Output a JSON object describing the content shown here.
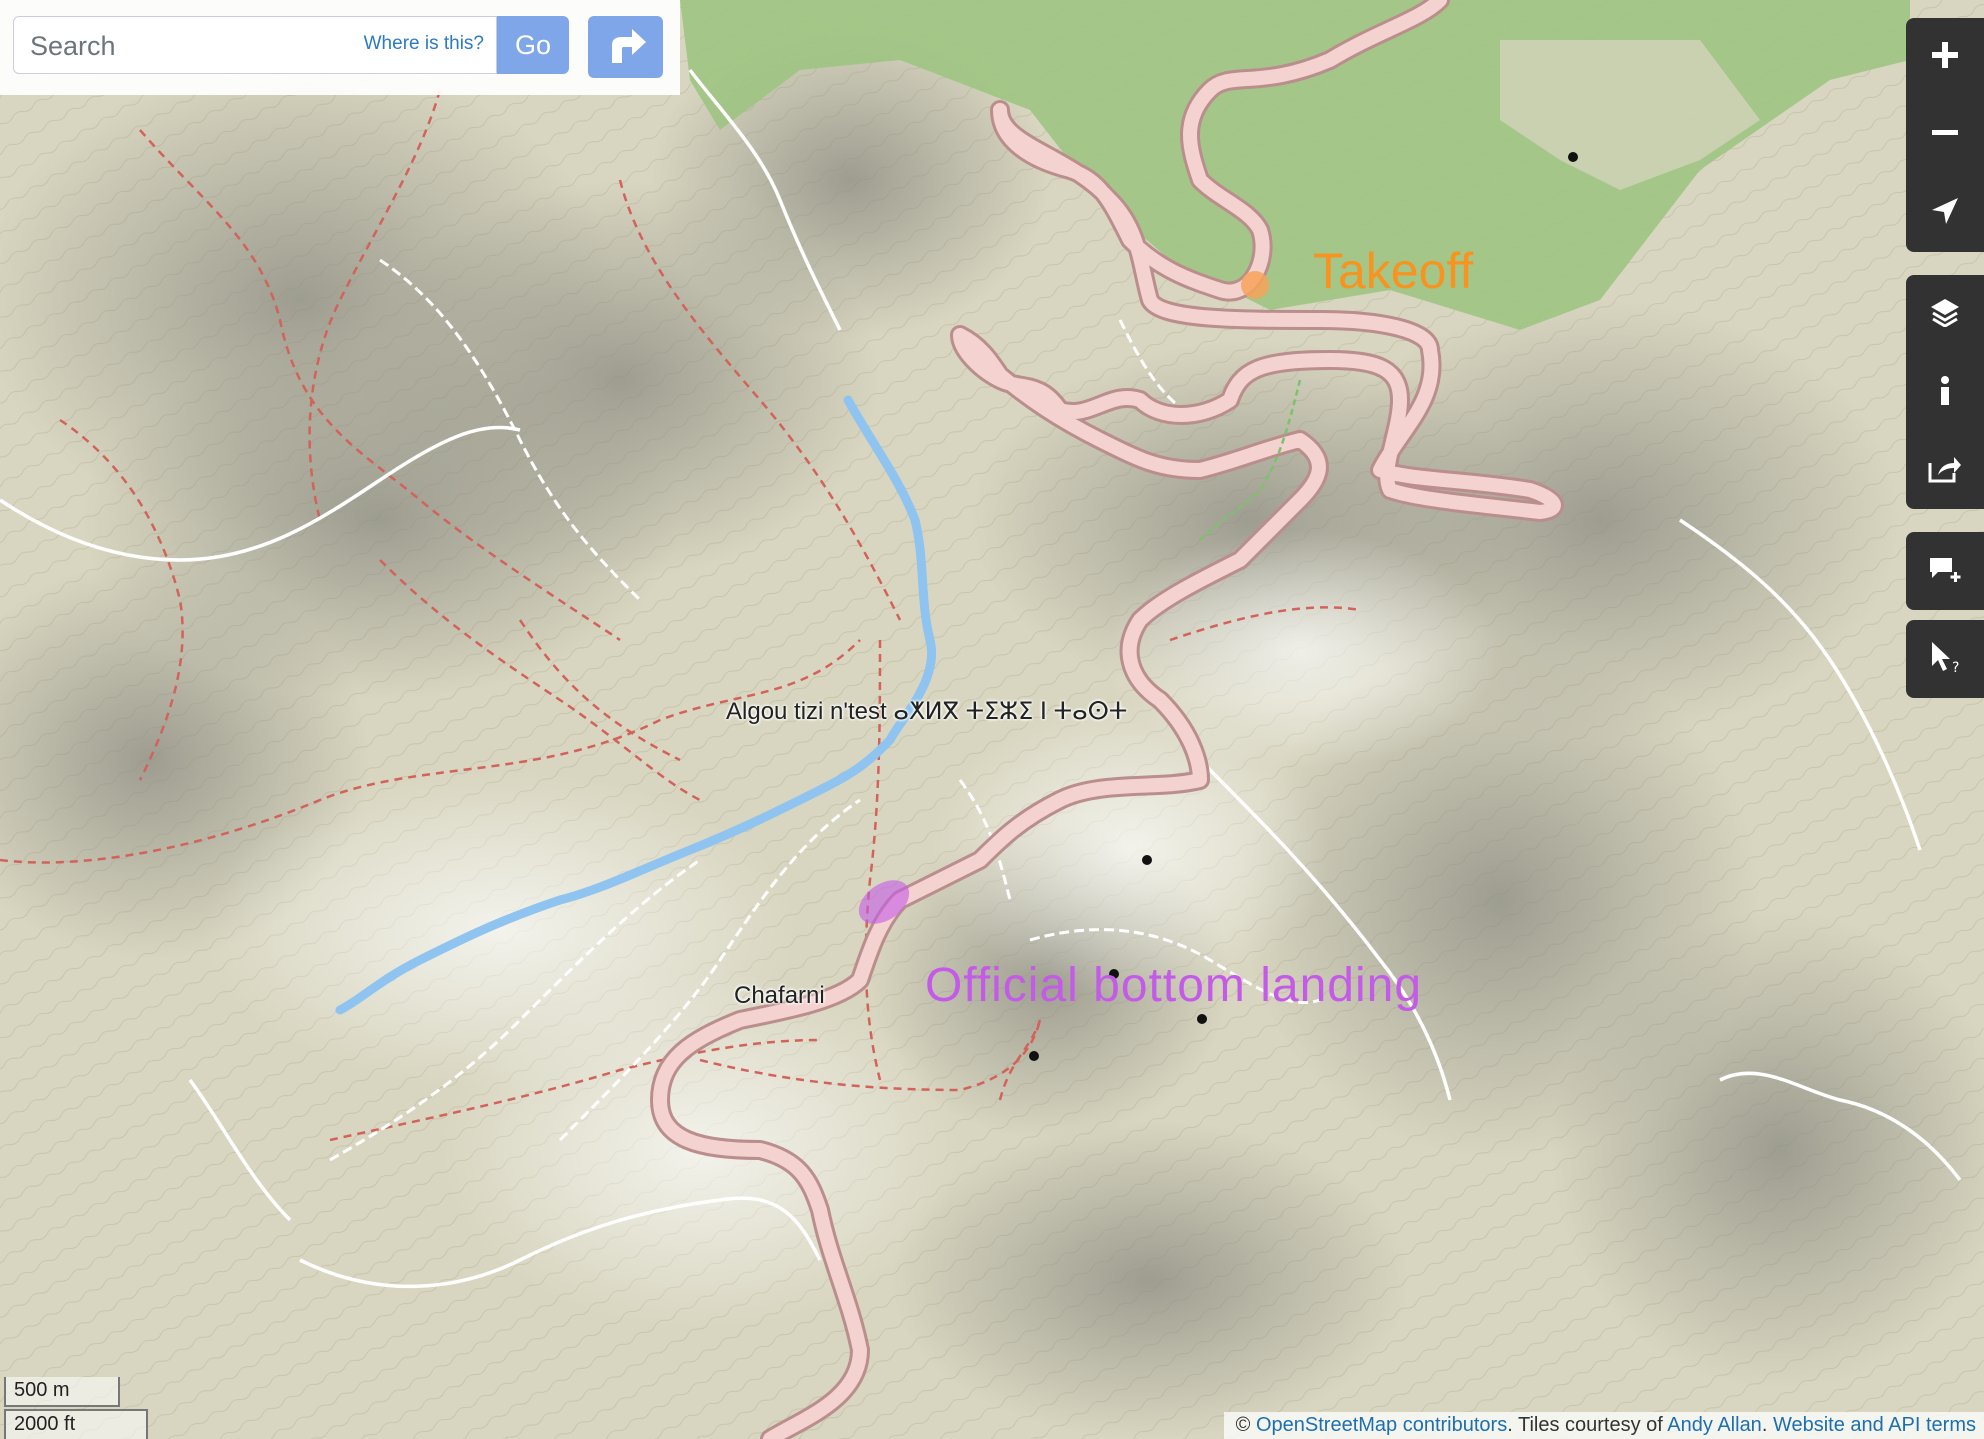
{
  "search": {
    "placeholder": "Search",
    "where_is_this": "Where is this?",
    "go_label": "Go"
  },
  "controls": {
    "zoom_in": "zoom-in",
    "zoom_out": "zoom-out",
    "locate": "locate",
    "layers": "layers",
    "info": "info",
    "share": "share",
    "add_note": "add-note",
    "query": "query-features"
  },
  "map_labels": {
    "place_algou": "Algou tizi n'test ⴰⵅⵍⴳ ⵜⵉⵣⵉ ⵏ ⵜⴰⵙⵜ",
    "place_chafarni": "Chafarni",
    "annotation_takeoff": "Takeoff",
    "annotation_landing": "Official bottom landing"
  },
  "scale": {
    "metric": "500 m",
    "imperial": "2000 ft"
  },
  "attribution": {
    "prefix": "© ",
    "osm": "OpenStreetMap contributors",
    "middle": ". Tiles courtesy of ",
    "author": "Andy Allan",
    "sep": ". ",
    "terms": "Website and API terms"
  },
  "colors": {
    "road": "#f1c6c4",
    "road_casing": "#c59a98",
    "river": "#8ec4ef",
    "forest": "#9bc47f",
    "path_red": "#d2625a",
    "takeoff": "#f7931e",
    "landing": "#c45ae8"
  }
}
